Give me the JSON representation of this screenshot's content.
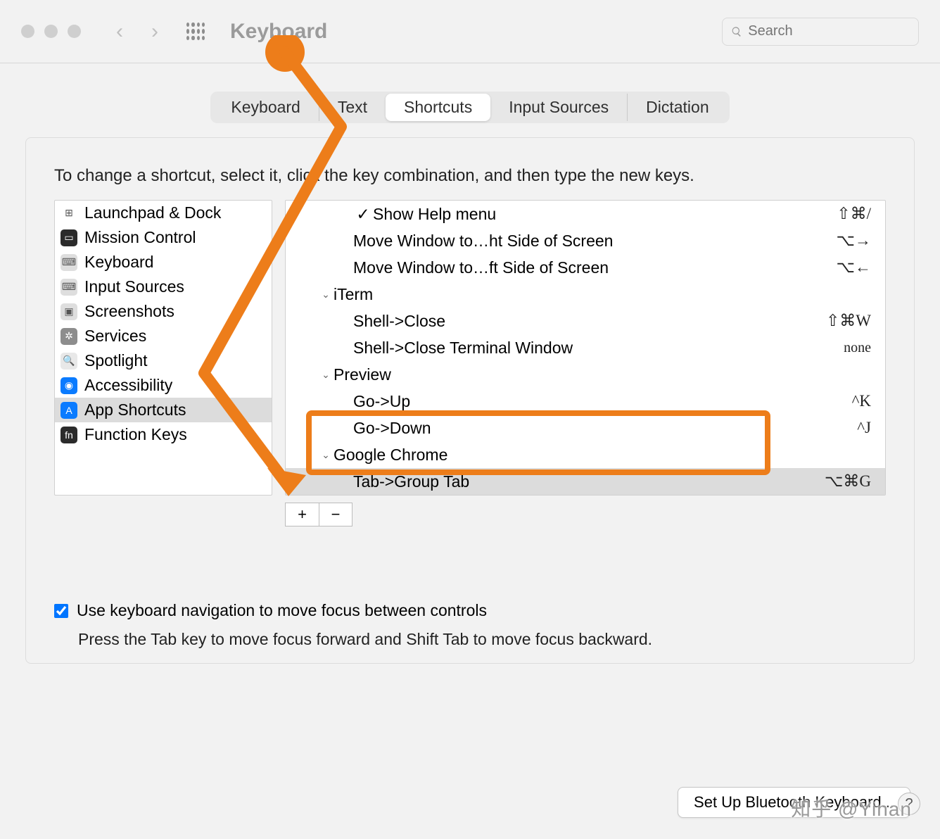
{
  "window": {
    "title": "Keyboard",
    "search_placeholder": "Search"
  },
  "tabs": [
    {
      "label": "Keyboard",
      "active": false
    },
    {
      "label": "Text",
      "active": false
    },
    {
      "label": "Shortcuts",
      "active": true
    },
    {
      "label": "Input Sources",
      "active": false
    },
    {
      "label": "Dictation",
      "active": false
    }
  ],
  "instruction": "To change a shortcut, select it, click the key combination, and then type the new keys.",
  "categories": [
    {
      "label": "Launchpad & Dock",
      "icon_bg": "#ffffff",
      "icon_glyph": "⊞"
    },
    {
      "label": "Mission Control",
      "icon_bg": "#2b2b2b",
      "icon_glyph": "▭"
    },
    {
      "label": "Keyboard",
      "icon_bg": "#dedede",
      "icon_glyph": "⌨"
    },
    {
      "label": "Input Sources",
      "icon_bg": "#dedede",
      "icon_glyph": "⌨"
    },
    {
      "label": "Screenshots",
      "icon_bg": "#dedede",
      "icon_glyph": "▣"
    },
    {
      "label": "Services",
      "icon_bg": "#8d8d8d",
      "icon_glyph": "✲"
    },
    {
      "label": "Spotlight",
      "icon_bg": "#e8e8e8",
      "icon_glyph": "🔍"
    },
    {
      "label": "Accessibility",
      "icon_bg": "#0a7bff",
      "icon_glyph": "◉"
    },
    {
      "label": "App Shortcuts",
      "icon_bg": "#0a7bff",
      "icon_glyph": "A",
      "selected": true
    },
    {
      "label": "Function Keys",
      "icon_bg": "#2b2b2b",
      "icon_glyph": "fn"
    }
  ],
  "shortcuts": [
    {
      "type": "item",
      "indent": 2,
      "checked": true,
      "label": "Show Help menu",
      "keys": "⇧⌘/"
    },
    {
      "type": "item",
      "indent": 2,
      "label": "Move Window to…ht Side of Screen",
      "keys": "⌥→"
    },
    {
      "type": "item",
      "indent": 2,
      "label": "Move Window to…ft Side of Screen",
      "keys": "⌥←"
    },
    {
      "type": "group",
      "indent": 1,
      "label": "iTerm"
    },
    {
      "type": "item",
      "indent": 2,
      "label": "Shell->Close",
      "keys": "⇧⌘W"
    },
    {
      "type": "item",
      "indent": 2,
      "label": "Shell->Close Terminal Window",
      "keys": "none",
      "none": true
    },
    {
      "type": "group",
      "indent": 1,
      "label": "Preview"
    },
    {
      "type": "item",
      "indent": 2,
      "label": "Go->Up",
      "keys": "^K"
    },
    {
      "type": "item",
      "indent": 2,
      "label": "Go->Down",
      "keys": "^J"
    },
    {
      "type": "group",
      "indent": 1,
      "label": "Google Chrome"
    },
    {
      "type": "item",
      "indent": 2,
      "label": "Tab->Group Tab",
      "keys": "⌥⌘G",
      "selected": true
    }
  ],
  "buttons": {
    "add": "+",
    "remove": "−"
  },
  "footer": {
    "checkbox_label": "Use keyboard navigation to move focus between controls",
    "hint": "Press the Tab key to move focus forward and Shift Tab to move focus backward."
  },
  "bottom_button": "Set Up Bluetooth Keyboard...",
  "watermark": "知乎 @Yinan"
}
